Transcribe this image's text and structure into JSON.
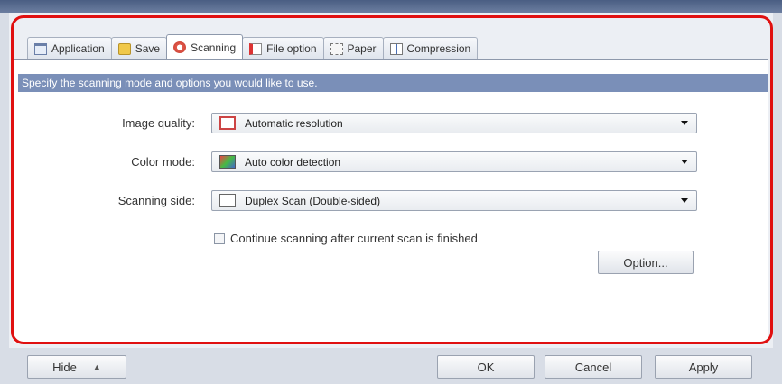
{
  "tabs": [
    {
      "label": "Application",
      "icon": "application-icon"
    },
    {
      "label": "Save",
      "icon": "save-icon"
    },
    {
      "label": "Scanning",
      "icon": "scanning-icon",
      "active": true
    },
    {
      "label": "File option",
      "icon": "file-option-icon"
    },
    {
      "label": "Paper",
      "icon": "paper-icon"
    },
    {
      "label": "Compression",
      "icon": "compression-icon"
    }
  ],
  "banner_text": "Specify the scanning mode and options you would like to use.",
  "fields": {
    "image_quality": {
      "label": "Image quality:",
      "value": "Automatic resolution"
    },
    "color_mode": {
      "label": "Color mode:",
      "value": "Auto color detection"
    },
    "scanning_side": {
      "label": "Scanning side:",
      "value": "Duplex Scan (Double-sided)"
    }
  },
  "continue_checkbox": {
    "label": "Continue scanning after current scan is finished",
    "checked": false
  },
  "buttons": {
    "option": "Option...",
    "hide": "Hide",
    "ok": "OK",
    "cancel": "Cancel",
    "apply": "Apply"
  },
  "colors": {
    "highlight": "#e01010",
    "banner": "#7a8fb8"
  }
}
